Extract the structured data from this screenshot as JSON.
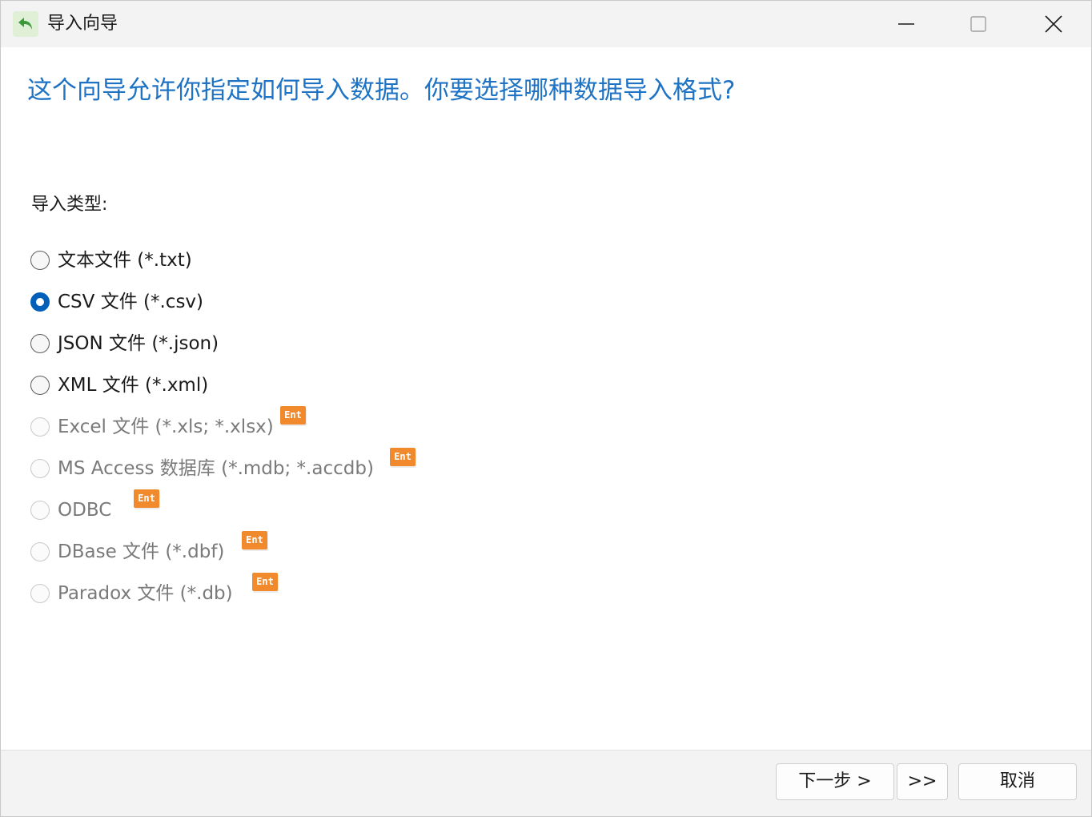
{
  "window": {
    "title": "导入向导",
    "icon": "undo-arrow-icon",
    "accent_color": "#1f73c4"
  },
  "heading": "这个向导允许你指定如何导入数据。你要选择哪种数据导入格式?",
  "import_type": {
    "label": "导入类型:",
    "selected": "CSV 文件 (*.csv)",
    "options": [
      {
        "label": "文本文件 (*.txt)",
        "checked": false,
        "enabled": true,
        "badge": ""
      },
      {
        "label": "CSV 文件 (*.csv)",
        "checked": true,
        "enabled": true,
        "badge": ""
      },
      {
        "label": "JSON 文件 (*.json)",
        "checked": false,
        "enabled": true,
        "badge": ""
      },
      {
        "label": "XML 文件 (*.xml)",
        "checked": false,
        "enabled": true,
        "badge": ""
      },
      {
        "label": "Excel 文件 (*.xls; *.xlsx)",
        "checked": false,
        "enabled": false,
        "badge": "Ent"
      },
      {
        "label": "MS Access 数据库 (*.mdb; *.accdb)",
        "checked": false,
        "enabled": false,
        "badge": "Ent"
      },
      {
        "label": "ODBC",
        "checked": false,
        "enabled": false,
        "badge": "Ent"
      },
      {
        "label": "DBase 文件 (*.dbf)",
        "checked": false,
        "enabled": false,
        "badge": "Ent"
      },
      {
        "label": "Paradox 文件 (*.db)",
        "checked": false,
        "enabled": false,
        "badge": "Ent"
      }
    ]
  },
  "footer": {
    "next_label": "下一步 >",
    "skip_label": ">>",
    "cancel_label": "取消"
  },
  "colors": {
    "radio_selected": "#005fb8",
    "badge": "#f08a2c"
  }
}
